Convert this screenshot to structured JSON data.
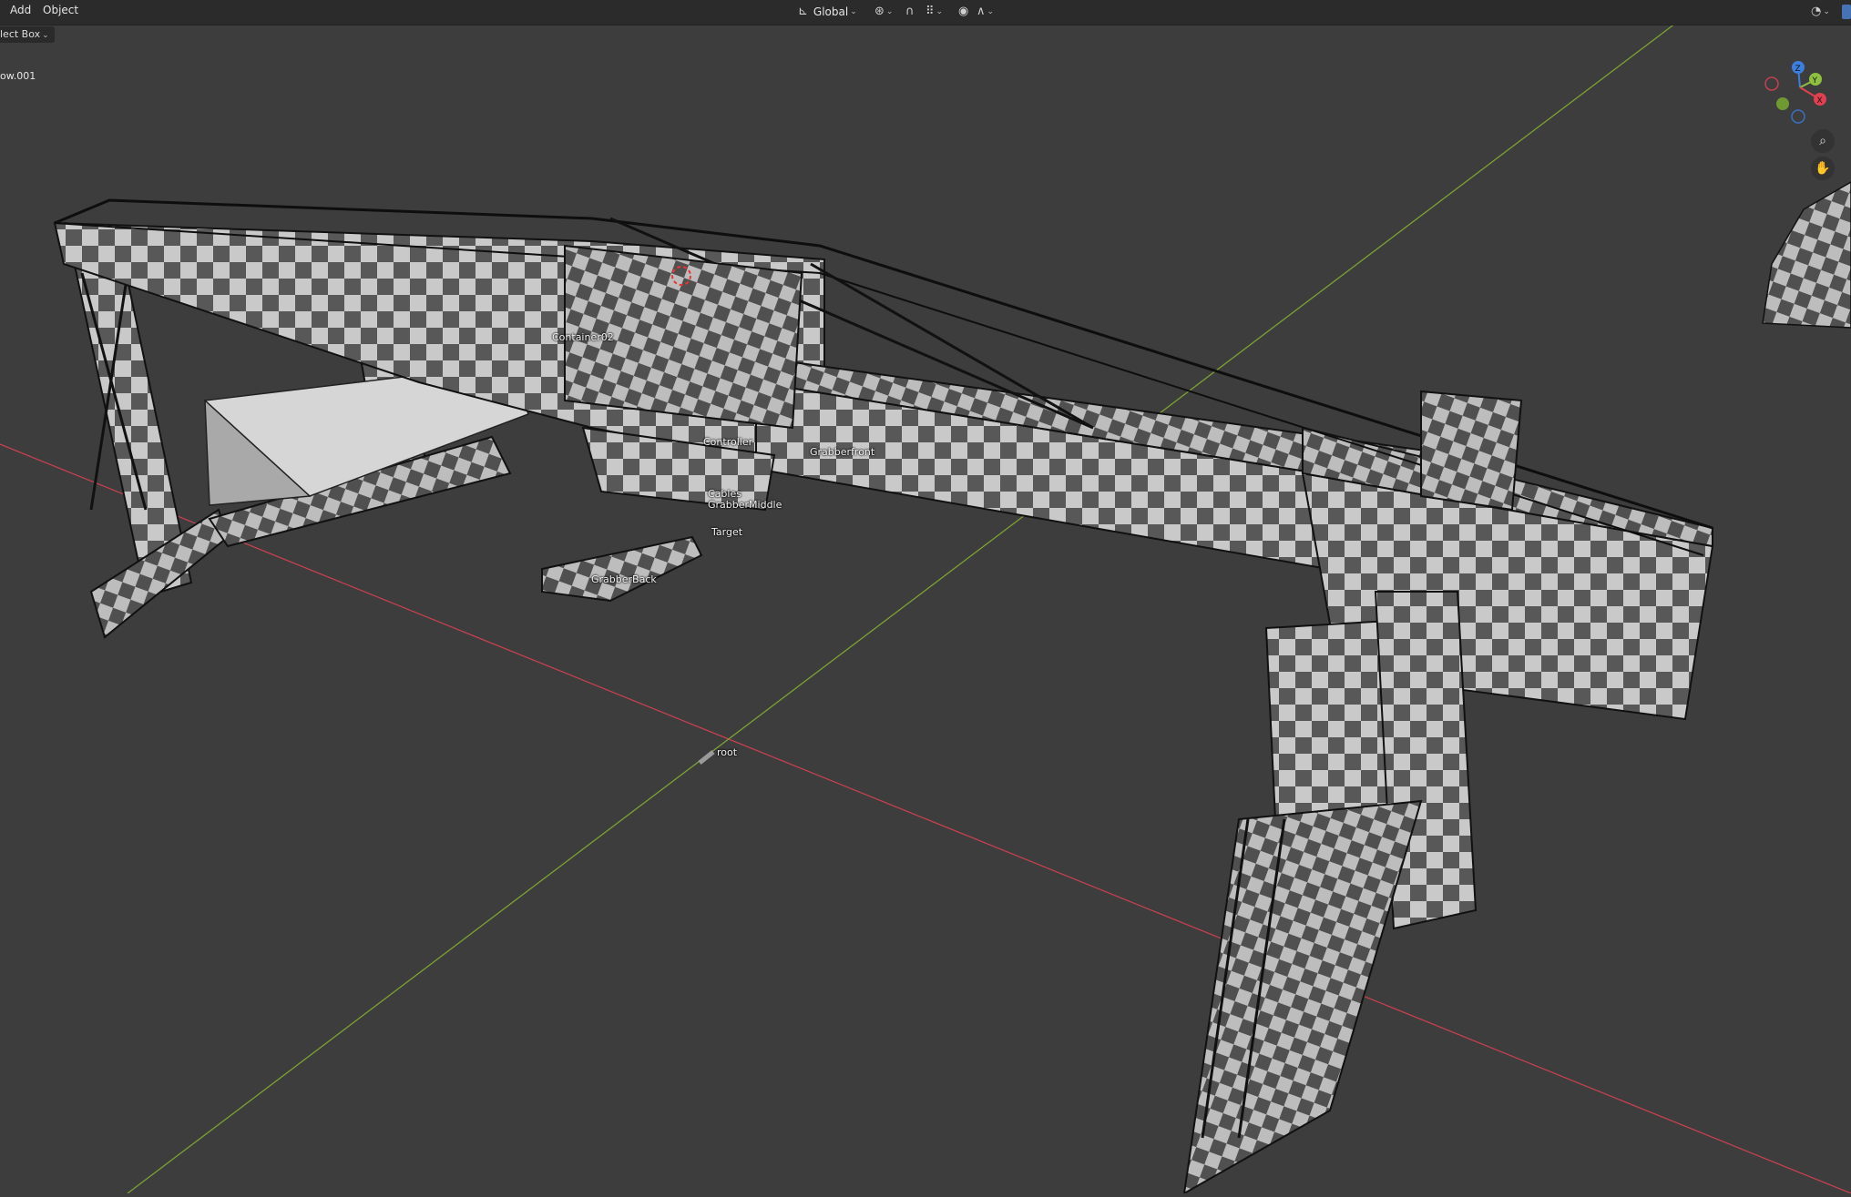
{
  "header": {
    "menu": [
      "Add",
      "Object"
    ],
    "transform_orientation": "Global"
  },
  "toolbar": {
    "select_mode": "lect Box"
  },
  "viewport": {
    "active_object_name": "ow.001",
    "object_labels": {
      "container": "Container02",
      "controller": "Controller",
      "grabber_front": "Grabberfront",
      "cables": "Cables",
      "grabber_middle": "GrabberMiddle",
      "target": "Target",
      "grabber_back": "GrabberBack",
      "root": "root"
    }
  },
  "gizmo": {
    "z": "Z",
    "y": "Y",
    "x": "X"
  },
  "colors": {
    "background": "#3d3d3d",
    "x_axis": "#c2414f",
    "y_axis": "#7da233",
    "header": "#2b2b2b"
  }
}
